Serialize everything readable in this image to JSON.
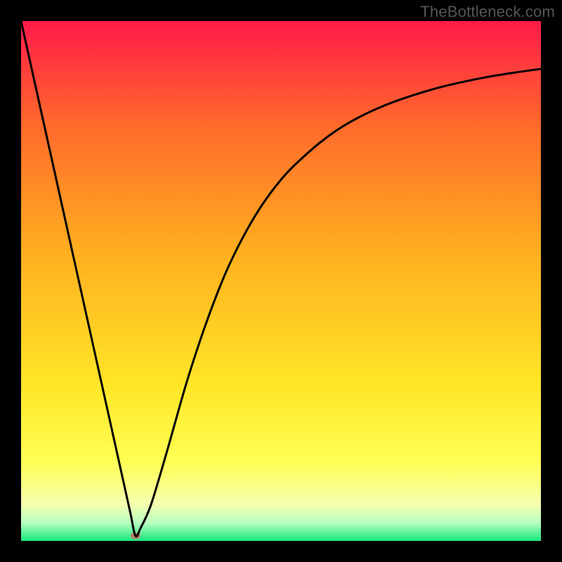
{
  "watermark": "TheBottleneck.com",
  "chart_data": {
    "type": "line",
    "title": "",
    "xlabel": "",
    "ylabel": "",
    "xlim": [
      0,
      100
    ],
    "ylim": [
      0,
      100
    ],
    "grid": false,
    "legend": false,
    "gradient_stops": [
      {
        "offset": 0,
        "color": "#ff1a49"
      },
      {
        "offset": 0.2,
        "color": "#ff6a2b"
      },
      {
        "offset": 0.45,
        "color": "#ffb020"
      },
      {
        "offset": 0.7,
        "color": "#ffe627"
      },
      {
        "offset": 0.85,
        "color": "#ffff55"
      },
      {
        "offset": 0.93,
        "color": "#f5ffb0"
      },
      {
        "offset": 0.965,
        "color": "#b8ffc0"
      },
      {
        "offset": 1.0,
        "color": "#17e87f"
      }
    ],
    "minimum_marker": {
      "x": 22,
      "y": 1.0,
      "color": "#b57f6a",
      "rx": 7,
      "ry": 5
    },
    "series": [
      {
        "name": "curve",
        "x": [
          0,
          5,
          10,
          15,
          19,
          21,
          22,
          23,
          25,
          28,
          32,
          36,
          40,
          45,
          50,
          55,
          60,
          65,
          70,
          75,
          80,
          85,
          90,
          95,
          100
        ],
        "y": [
          100,
          77.5,
          55,
          32.5,
          14.5,
          5.5,
          1.0,
          2.5,
          7.0,
          17,
          31,
          43,
          53,
          62.5,
          69.5,
          74.5,
          78.5,
          81.5,
          83.8,
          85.6,
          87.1,
          88.3,
          89.3,
          90.1,
          90.8
        ]
      }
    ]
  }
}
